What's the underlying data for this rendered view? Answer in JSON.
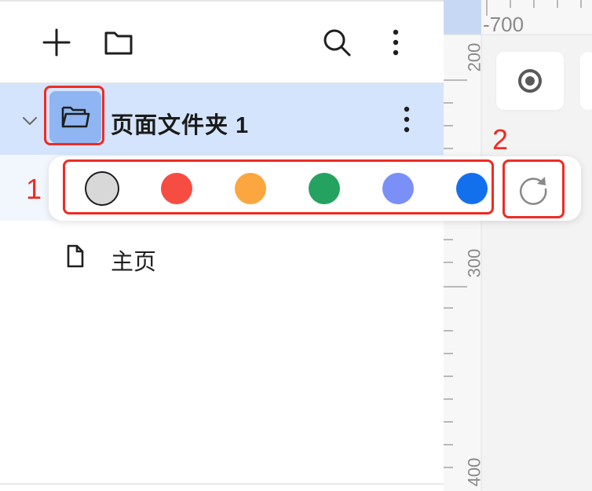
{
  "toolbar": {
    "add_icon": "plus-icon",
    "folder_icon": "folder-icon",
    "search_icon": "search-icon",
    "more_icon": "more-vertical-icon"
  },
  "tree": {
    "folder": {
      "name": "页面文件夹 1",
      "expanded": true
    },
    "pages": [
      {
        "label": "主页"
      }
    ]
  },
  "color_picker": {
    "swatches": [
      {
        "name": "gray",
        "color": "#d8d8d8",
        "selected": true
      },
      {
        "name": "red",
        "color": "#f74c42"
      },
      {
        "name": "orange",
        "color": "#fca63f"
      },
      {
        "name": "green",
        "color": "#24a260"
      },
      {
        "name": "periwinkle",
        "color": "#7a90f7"
      },
      {
        "name": "blue",
        "color": "#1370ec"
      }
    ],
    "reset_icon": "reset-icon"
  },
  "rulers": {
    "top_label": "-700",
    "left_labels": [
      "200",
      "300",
      "400"
    ]
  },
  "annotations": {
    "label_1": "1",
    "label_2": "2",
    "color": "#ef2b24"
  }
}
